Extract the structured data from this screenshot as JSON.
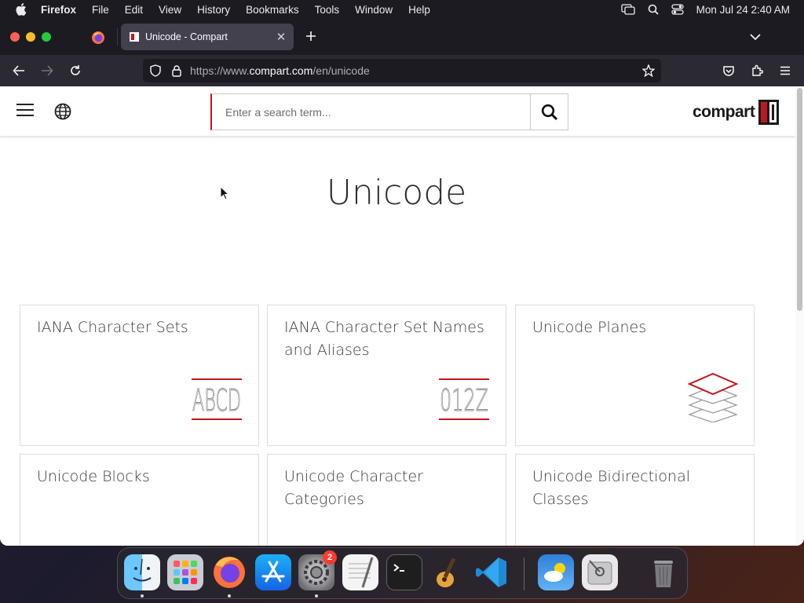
{
  "menubar": {
    "app_name": "Firefox",
    "items": [
      "File",
      "Edit",
      "View",
      "History",
      "Bookmarks",
      "Tools",
      "Window",
      "Help"
    ],
    "clock": "Mon Jul 24  2:40 AM"
  },
  "browser": {
    "tab_title": "Unicode - Compart",
    "url_prefix": "https://www.",
    "url_domain": "compart.com",
    "url_path": "/en/unicode"
  },
  "site": {
    "search_placeholder": "Enter a search term...",
    "logo_text": "compart",
    "page_title": "Unicode",
    "cards": [
      {
        "title": "IANA Character Sets",
        "icon": "abcd-letters-icon",
        "icon_text": "ABCD"
      },
      {
        "title": "IANA Character Set Names and Aliases",
        "icon": "digits-icon",
        "icon_text": "012Z"
      },
      {
        "title": "Unicode Planes",
        "icon": "layers-icon"
      },
      {
        "title": "Unicode Blocks",
        "icon": "cube-icon"
      },
      {
        "title": "Unicode Character Categories",
        "icon": "folder-icon"
      },
      {
        "title": "Unicode Bidirectional Classes",
        "icon": "bidi-triangles-icon"
      }
    ]
  },
  "dock": {
    "apps": [
      "Finder",
      "Launchpad",
      "Firefox",
      "App Store",
      "System Settings",
      "TextEdit",
      "Terminal",
      "GarageBand",
      "Visual Studio Code",
      "Weather",
      "Disk Utility",
      "Trash"
    ],
    "system_settings_badge": "2"
  },
  "colors": {
    "brand_red": "#c0171e",
    "toolbar_dark": "#2b2a33",
    "tab_active": "#42414d"
  }
}
